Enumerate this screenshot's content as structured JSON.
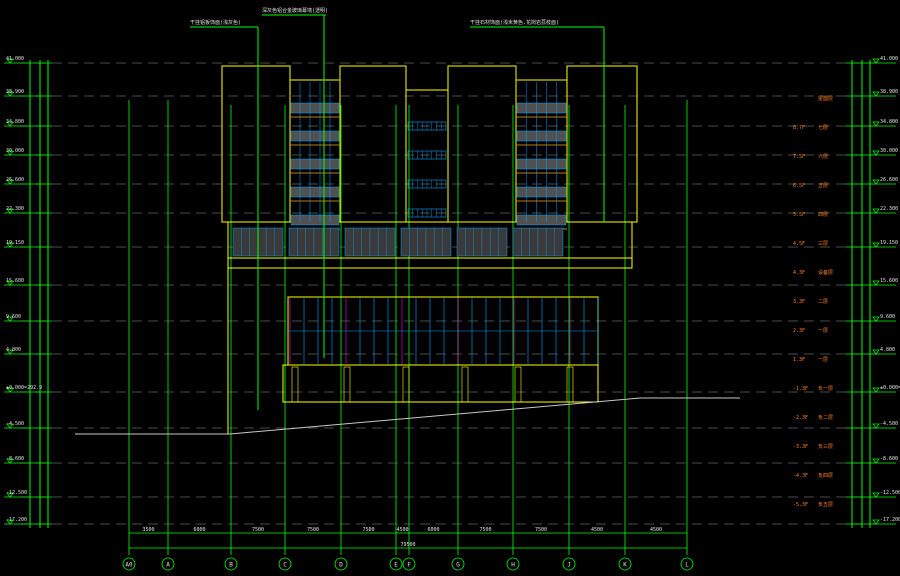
{
  "colors": {
    "background": "#000000",
    "grid": "#c8c8c8",
    "axis": "#00ff00",
    "outline": "#ffff00",
    "panel": "#00a0ff",
    "accent": "#ff00ff",
    "floor_label": "#ff8020"
  },
  "annotations": {
    "note_left": "干挂铝板饰面(浅灰色)",
    "note_mid": "深灰色铝合金玻璃幕墙(透明)",
    "note_right": "干挂石材饰面(浅米黄色,花岗岩荔枝面)"
  },
  "levels_left": [
    "41.000",
    "38.900",
    "34.800",
    "30.000",
    "26.600",
    "22.300",
    "19.150",
    "15.600",
    "9.600",
    "4.800",
    "±0.000=292.9",
    "-4.500",
    "-8.600",
    "-12.500",
    "-17.200"
  ],
  "levels_right": [
    "41.000",
    "38.900",
    "34.800",
    "30.000",
    "26.600",
    "22.300",
    "19.150",
    "15.600",
    "9.600",
    "4.800",
    "±0.000=292.9",
    "-4.500",
    "-8.600",
    "-12.500",
    "-17.200"
  ],
  "floor_labels": [
    {
      "name": "屋面层",
      "elev": ""
    },
    {
      "name": "七层",
      "elev": "8.7F"
    },
    {
      "name": "六层",
      "elev": "7.5F"
    },
    {
      "name": "五层",
      "elev": "6.5F"
    },
    {
      "name": "四层",
      "elev": "5.5F"
    },
    {
      "name": "三层",
      "elev": "4.5F"
    },
    {
      "name": "设备层",
      "elev": "4.3F"
    },
    {
      "name": "二层",
      "elev": "3.3F"
    },
    {
      "name": "一层",
      "elev": "2.3F"
    },
    {
      "name": "一层",
      "elev": "1.3F"
    },
    {
      "name": "负一层",
      "elev": "-1.3F"
    },
    {
      "name": "负二层",
      "elev": "-2.3F"
    },
    {
      "name": "负三层",
      "elev": "-3.3F"
    },
    {
      "name": "负四层",
      "elev": "-4.3F"
    },
    {
      "name": "负五层",
      "elev": "-5.3F"
    }
  ],
  "axes": [
    "A0",
    "A",
    "B",
    "C",
    "D",
    "E",
    "F",
    "G",
    "H",
    "J",
    "K",
    "L"
  ],
  "bay_dims": [
    "3500",
    "6000",
    "7500",
    "7500",
    "7500",
    "4500",
    "6000",
    "7500",
    "7500",
    "4500",
    "4500"
  ],
  "total_dim": "79500"
}
